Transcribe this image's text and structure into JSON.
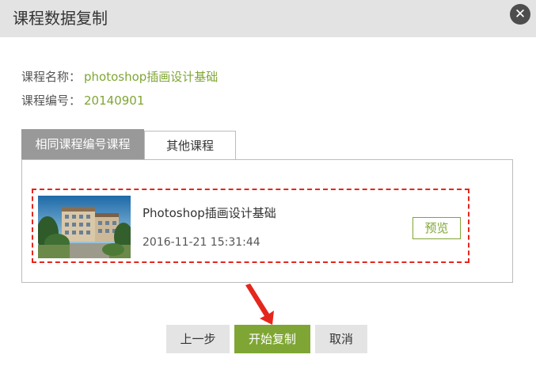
{
  "dialog": {
    "title": "课程数据复制",
    "close_icon": "✕"
  },
  "course_info": {
    "name_label": "课程名称：",
    "name_value": "photoshop插画设计基础",
    "code_label": "课程编号：",
    "code_value": "20140901"
  },
  "tabs": [
    {
      "label": "相同课程编号课程",
      "active": true
    },
    {
      "label": "其他课程",
      "active": false
    }
  ],
  "course_list": [
    {
      "title": "Photoshop插画设计基础",
      "timestamp": "2016-11-21 15:31:44",
      "preview_label": "预览",
      "highlighted": true
    }
  ],
  "buttons": {
    "prev_label": "上一步",
    "start_label": "开始复制",
    "cancel_label": "取消"
  },
  "colors": {
    "accent_green": "#7fa634",
    "highlight_red": "#e5261d",
    "titlebar_bg": "#e3e3e3",
    "active_tab_bg": "#999999"
  },
  "icons": {
    "close": "close-icon",
    "pointer": "red-arrow-icon"
  }
}
